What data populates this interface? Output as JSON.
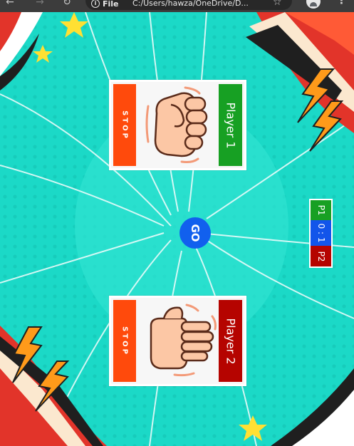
{
  "browser": {
    "back_icon": "arrow-left-icon",
    "forward_icon": "arrow-right-icon",
    "reload_icon": "reload-icon",
    "chip_label": "File",
    "url": "C:/Users/hawza/OneDrive/D...",
    "bookmark_icon": "star-icon",
    "profile_icon": "person-icon",
    "menu_icon": "kebab-icon"
  },
  "game": {
    "player1": {
      "name": "Player 1",
      "stop_label": "STOP",
      "hand": "rock",
      "color": "#17a023"
    },
    "player2": {
      "name": "Player 2",
      "stop_label": "STOP",
      "hand": "paper",
      "color": "#b50400"
    },
    "go_label": "GO",
    "score": {
      "p1_label": "P1",
      "value": "0 : 1",
      "p2_label": "P2"
    },
    "colors": {
      "background": "#1bd9c7",
      "stop": "#ff4a0c",
      "go": "#1160ee",
      "score_mid": "#1255ea"
    }
  }
}
